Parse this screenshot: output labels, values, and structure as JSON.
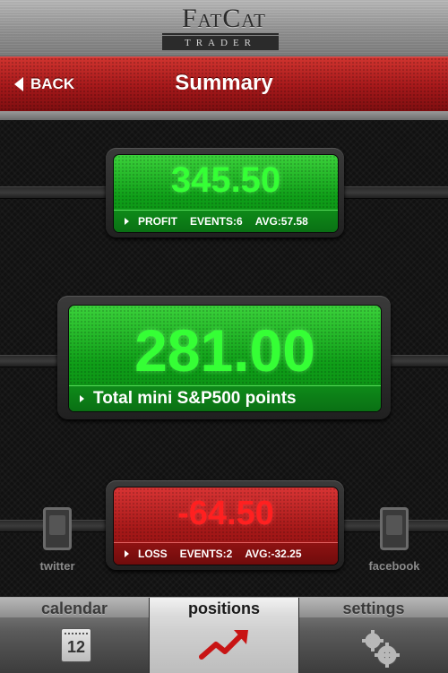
{
  "brand": {
    "top": "FatCat",
    "bottom": "TRADER"
  },
  "nav": {
    "back_label": "BACK",
    "title": "Summary"
  },
  "profit": {
    "value": "345.50",
    "label": "PROFIT",
    "events": "EVENTS:6",
    "avg": "AVG:57.58"
  },
  "total": {
    "value": "281.00",
    "label": "Total mini S&P500 points"
  },
  "loss": {
    "value": "-64.50",
    "label": "LOSS",
    "events": "EVENTS:2",
    "avg": "AVG:-32.25"
  },
  "social": {
    "twitter": "twitter",
    "facebook": "facebook"
  },
  "tabs": [
    {
      "label": "calendar",
      "icon": "calendar-icon",
      "day": "12"
    },
    {
      "label": "positions",
      "icon": "trend-up-icon",
      "active": true
    },
    {
      "label": "settings",
      "icon": "gear-icon"
    }
  ],
  "colors": {
    "profit": "#35ff35",
    "loss": "#ff2020",
    "nav": "#b3201f"
  }
}
